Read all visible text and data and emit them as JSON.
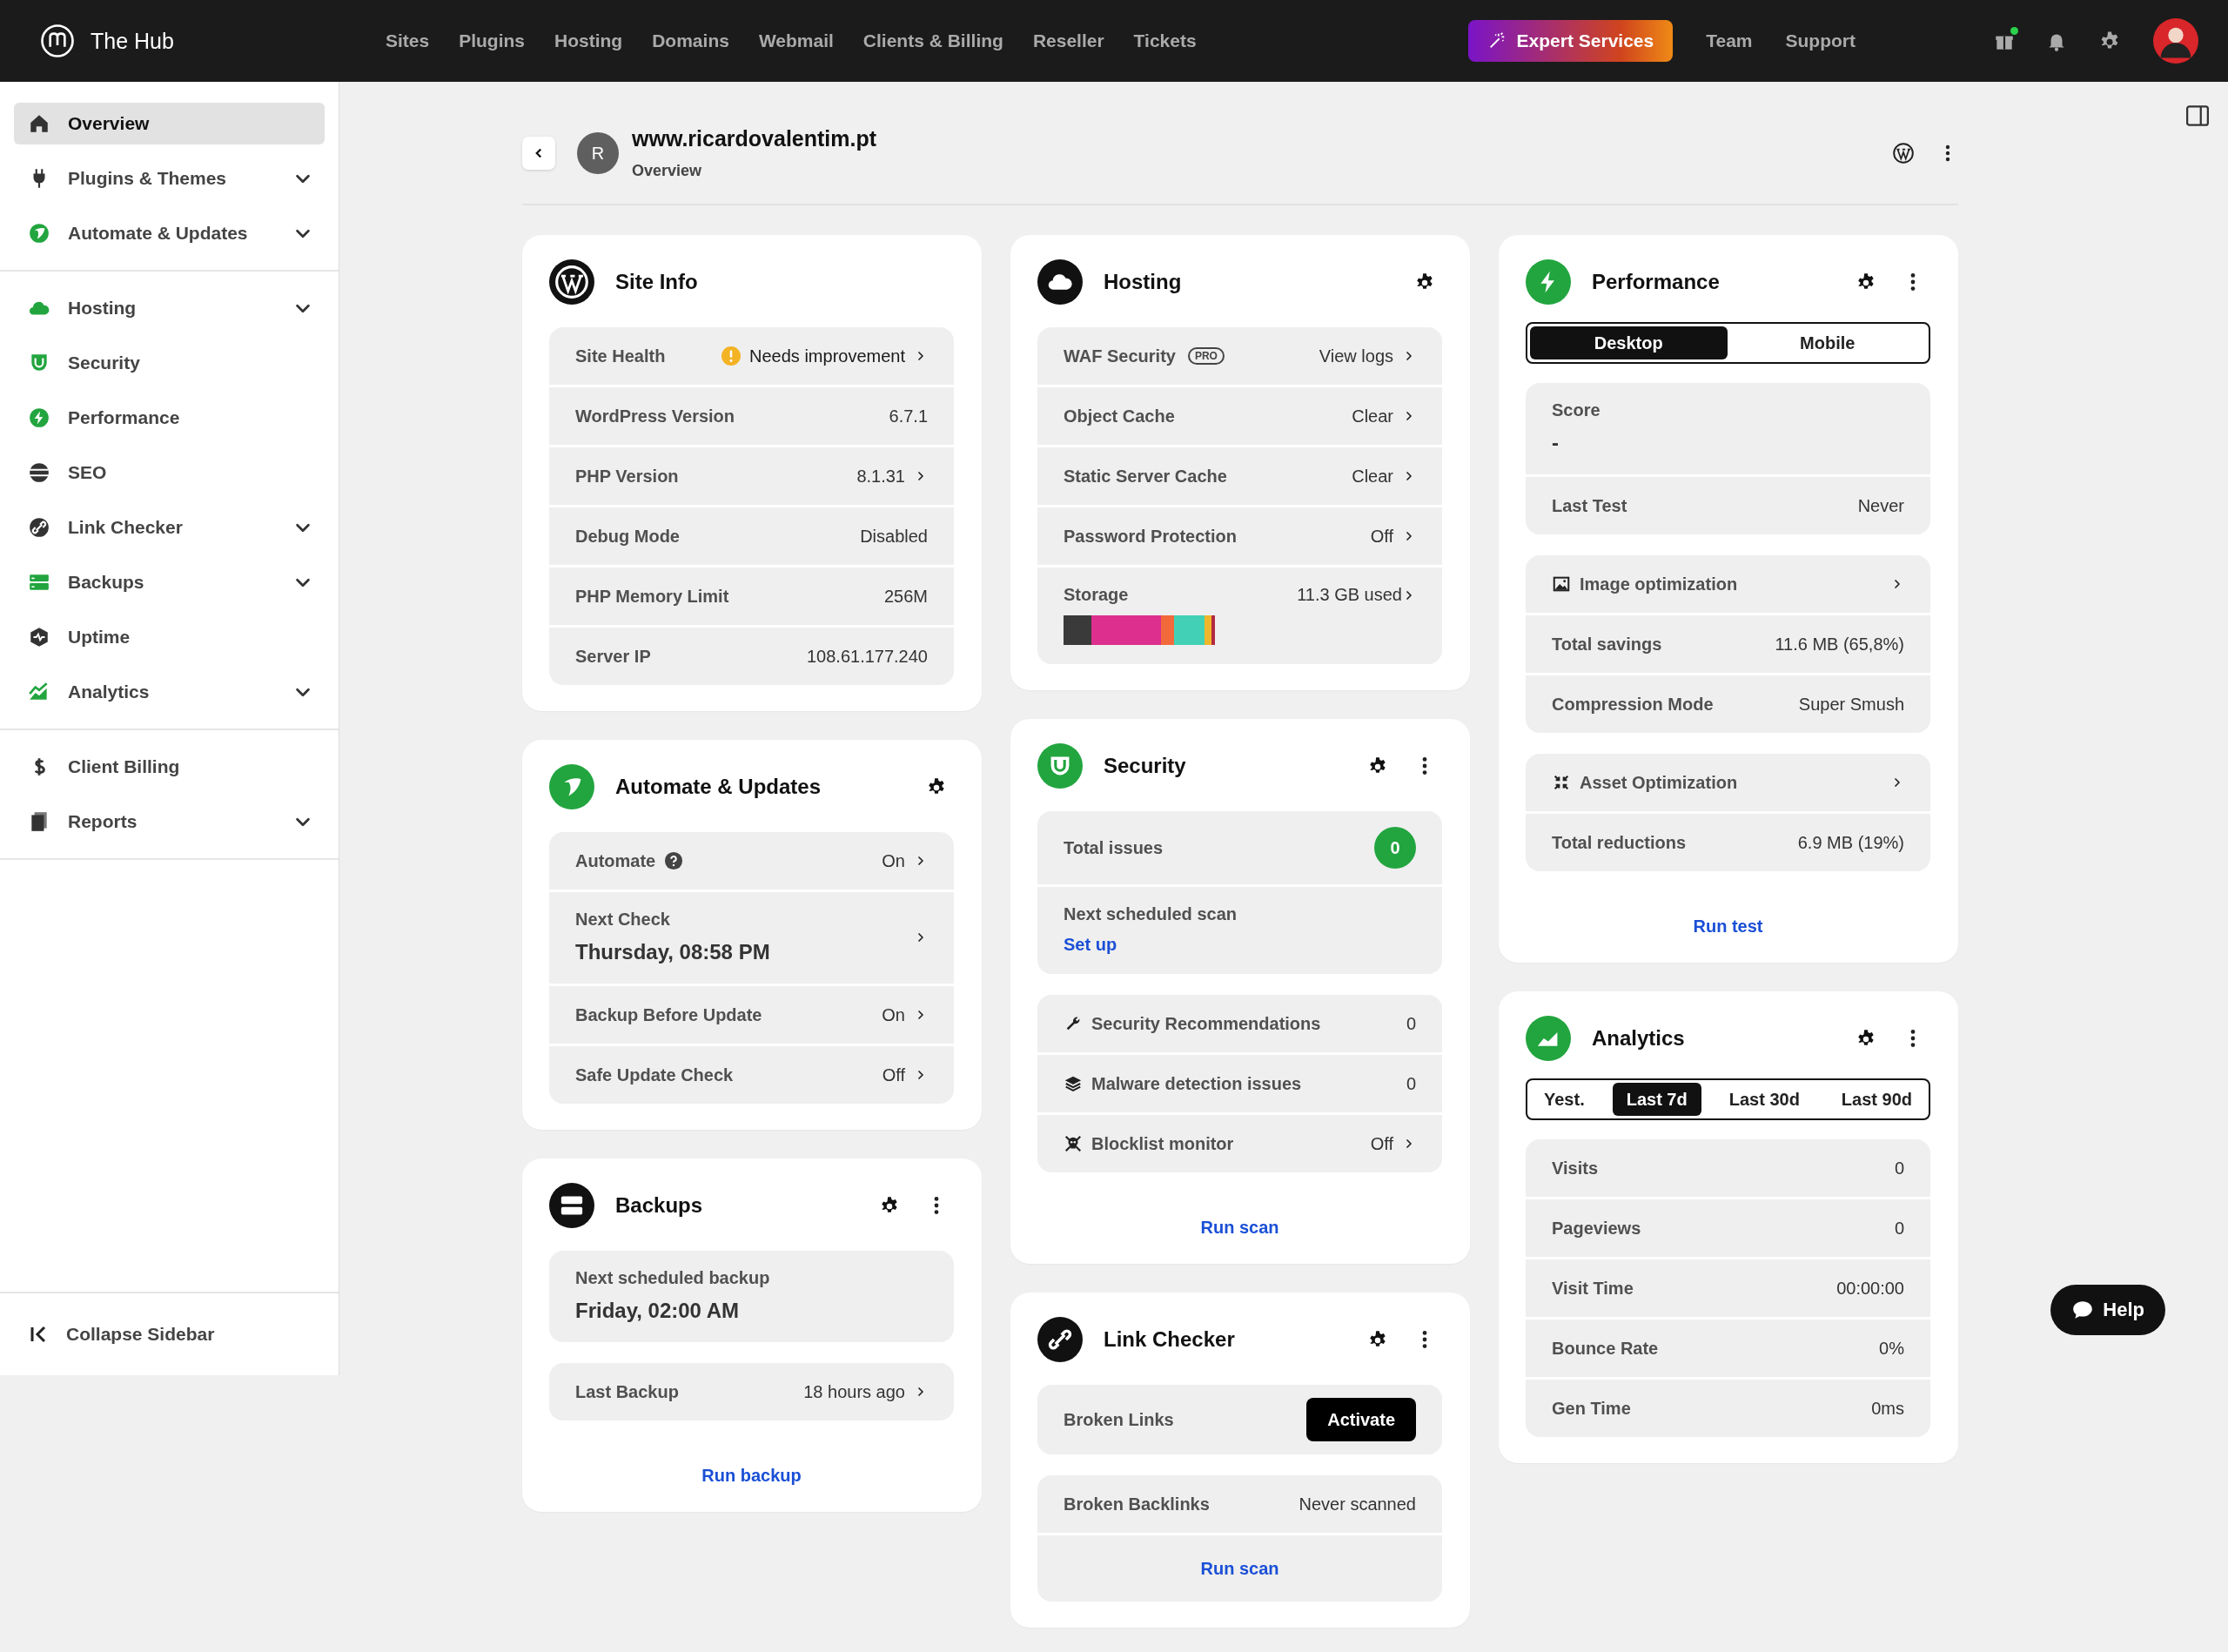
{
  "topbar": {
    "brand": "The Hub",
    "nav": [
      "Sites",
      "Plugins",
      "Hosting",
      "Domains",
      "Webmail",
      "Clients & Billing",
      "Reseller",
      "Tickets"
    ],
    "expert_button": "Expert Services",
    "links": [
      "Team",
      "Support"
    ],
    "notification_dot": true
  },
  "sidebar": {
    "groups": [
      [
        {
          "label": "Overview",
          "selected": true,
          "expandable": false
        },
        {
          "label": "Plugins & Themes",
          "selected": false,
          "expandable": true
        },
        {
          "label": "Automate & Updates",
          "selected": false,
          "expandable": true
        }
      ],
      [
        {
          "label": "Hosting",
          "selected": false,
          "expandable": true
        },
        {
          "label": "Security",
          "selected": false,
          "expandable": false
        },
        {
          "label": "Performance",
          "selected": false,
          "expandable": false
        },
        {
          "label": "SEO",
          "selected": false,
          "expandable": false
        },
        {
          "label": "Link Checker",
          "selected": false,
          "expandable": true
        },
        {
          "label": "Backups",
          "selected": false,
          "expandable": true
        },
        {
          "label": "Uptime",
          "selected": false,
          "expandable": false
        },
        {
          "label": "Analytics",
          "selected": false,
          "expandable": true
        }
      ],
      [
        {
          "label": "Client Billing",
          "selected": false,
          "expandable": false
        },
        {
          "label": "Reports",
          "selected": false,
          "expandable": true
        }
      ]
    ],
    "collapse": "Collapse Sidebar"
  },
  "site_header": {
    "avatar_letter": "R",
    "domain": "www.ricardovalentim.pt",
    "subtitle": "Overview"
  },
  "columns": [
    [
      {
        "title": "Site Info",
        "settings": false,
        "more": false,
        "groups": [
          [
            {
              "kind": "pair",
              "label": "Site Health",
              "value": "Needs improvement",
              "warning": true,
              "chevron": true
            },
            {
              "kind": "pair",
              "label": "WordPress Version",
              "value": "6.7.1",
              "chevron": false
            },
            {
              "kind": "pair",
              "label": "PHP Version",
              "value": "8.1.31",
              "chevron": true
            },
            {
              "kind": "pair",
              "label": "Debug Mode",
              "value": "Disabled",
              "chevron": false
            },
            {
              "kind": "pair",
              "label": "PHP Memory Limit",
              "value": "256M",
              "chevron": false
            },
            {
              "kind": "pair",
              "label": "Server IP",
              "value": "108.61.177.240",
              "chevron": false
            }
          ]
        ]
      },
      {
        "title": "Automate & Updates",
        "settings": true,
        "more": false,
        "groups": [
          [
            {
              "kind": "pair",
              "label": "Automate",
              "value": "On",
              "help": true,
              "chevron": true
            },
            {
              "kind": "stacked",
              "label": "Next Check",
              "value": "Thursday, 08:58 PM",
              "chevron": true
            },
            {
              "kind": "pair",
              "label": "Backup Before Update",
              "value": "On",
              "chevron": true
            },
            {
              "kind": "pair",
              "label": "Safe Update Check",
              "value": "Off",
              "chevron": true
            }
          ]
        ]
      },
      {
        "title": "Backups",
        "settings": true,
        "more": true,
        "groups": [
          [
            {
              "kind": "stacked",
              "label": "Next scheduled backup",
              "value": "Friday, 02:00 AM",
              "chevron": false
            }
          ],
          [
            {
              "kind": "pair",
              "label": "Last Backup",
              "value": "18 hours ago",
              "chevron": true
            }
          ]
        ],
        "footer_link": "Run backup"
      }
    ],
    [
      {
        "title": "Hosting",
        "settings": true,
        "more": false,
        "groups": [
          [
            {
              "kind": "pair",
              "label": "WAF Security",
              "badge": "PRO",
              "value": "View logs",
              "chevron": true
            },
            {
              "kind": "pair",
              "label": "Object Cache",
              "value": "Clear",
              "chevron": true
            },
            {
              "kind": "pair",
              "label": "Static Server Cache",
              "value": "Clear",
              "chevron": true
            },
            {
              "kind": "pair",
              "label": "Password Protection",
              "value": "Off",
              "chevron": true
            },
            {
              "kind": "storage",
              "label": "Storage",
              "value": "11.3 GB used",
              "chevron": true
            }
          ]
        ]
      },
      {
        "title": "Security",
        "settings": true,
        "more": true,
        "groups": [
          [
            {
              "kind": "count",
              "label": "Total issues",
              "value": "0"
            },
            {
              "kind": "stacked-link",
              "label": "Next scheduled scan",
              "value": "Set up"
            }
          ],
          [
            {
              "kind": "pair",
              "label": "Security Recommendations",
              "icon": true,
              "value": "0",
              "chevron": false
            },
            {
              "kind": "pair",
              "label": "Malware detection issues",
              "icon": true,
              "value": "0",
              "chevron": false
            },
            {
              "kind": "pair",
              "label": "Blocklist monitor",
              "icon": true,
              "value": "Off",
              "chevron": true
            }
          ]
        ],
        "footer_link": "Run scan"
      },
      {
        "title": "Link Checker",
        "settings": true,
        "more": true,
        "groups": [
          [
            {
              "kind": "button",
              "label": "Broken Links",
              "value": "Activate"
            }
          ],
          [
            {
              "kind": "pair",
              "label": "Broken Backlinks",
              "value": "Never scanned",
              "chevron": false
            },
            {
              "kind": "action",
              "value": "Run scan"
            }
          ]
        ]
      }
    ],
    [
      {
        "title": "Performance",
        "settings": true,
        "more": true,
        "tabs": [
          {
            "label": "Desktop",
            "selected": true
          },
          {
            "label": "Mobile",
            "selected": false
          }
        ],
        "groups": [
          [
            {
              "kind": "stacked",
              "label": "Score",
              "value": "-",
              "chevron": false
            },
            {
              "kind": "pair",
              "label": "Last Test",
              "value": "Never",
              "chevron": false
            }
          ],
          [
            {
              "kind": "pair",
              "label": "Image optimization",
              "icon": true,
              "chevron": true
            },
            {
              "kind": "pair",
              "label": "Total savings",
              "value": "11.6 MB (65,8%)",
              "chevron": false
            },
            {
              "kind": "pair",
              "label": "Compression Mode",
              "value": "Super Smush",
              "chevron": false
            }
          ],
          [
            {
              "kind": "pair",
              "label": "Asset Optimization",
              "icon": true,
              "chevron": true
            },
            {
              "kind": "pair",
              "label": "Total reductions",
              "value": "6.9 MB (19%)",
              "chevron": false
            }
          ]
        ],
        "footer_link": "Run test"
      },
      {
        "title": "Analytics",
        "settings": true,
        "more": true,
        "tabs": [
          {
            "label": "Yest.",
            "selected": false
          },
          {
            "label": "Last 7d",
            "selected": true
          },
          {
            "label": "Last 30d",
            "selected": false
          },
          {
            "label": "Last 90d",
            "selected": false
          }
        ],
        "groups": [
          [
            {
              "kind": "pair",
              "label": "Visits",
              "value": "0",
              "chevron": false
            },
            {
              "kind": "pair",
              "label": "Pageviews",
              "value": "0",
              "chevron": false
            },
            {
              "kind": "pair",
              "label": "Visit Time",
              "value": "00:00:00",
              "chevron": false
            },
            {
              "kind": "pair",
              "label": "Bounce Rate",
              "value": "0%",
              "chevron": false
            },
            {
              "kind": "pair",
              "label": "Gen Time",
              "value": "0ms",
              "chevron": false
            }
          ]
        ]
      }
    ]
  ],
  "help_button": "Help"
}
